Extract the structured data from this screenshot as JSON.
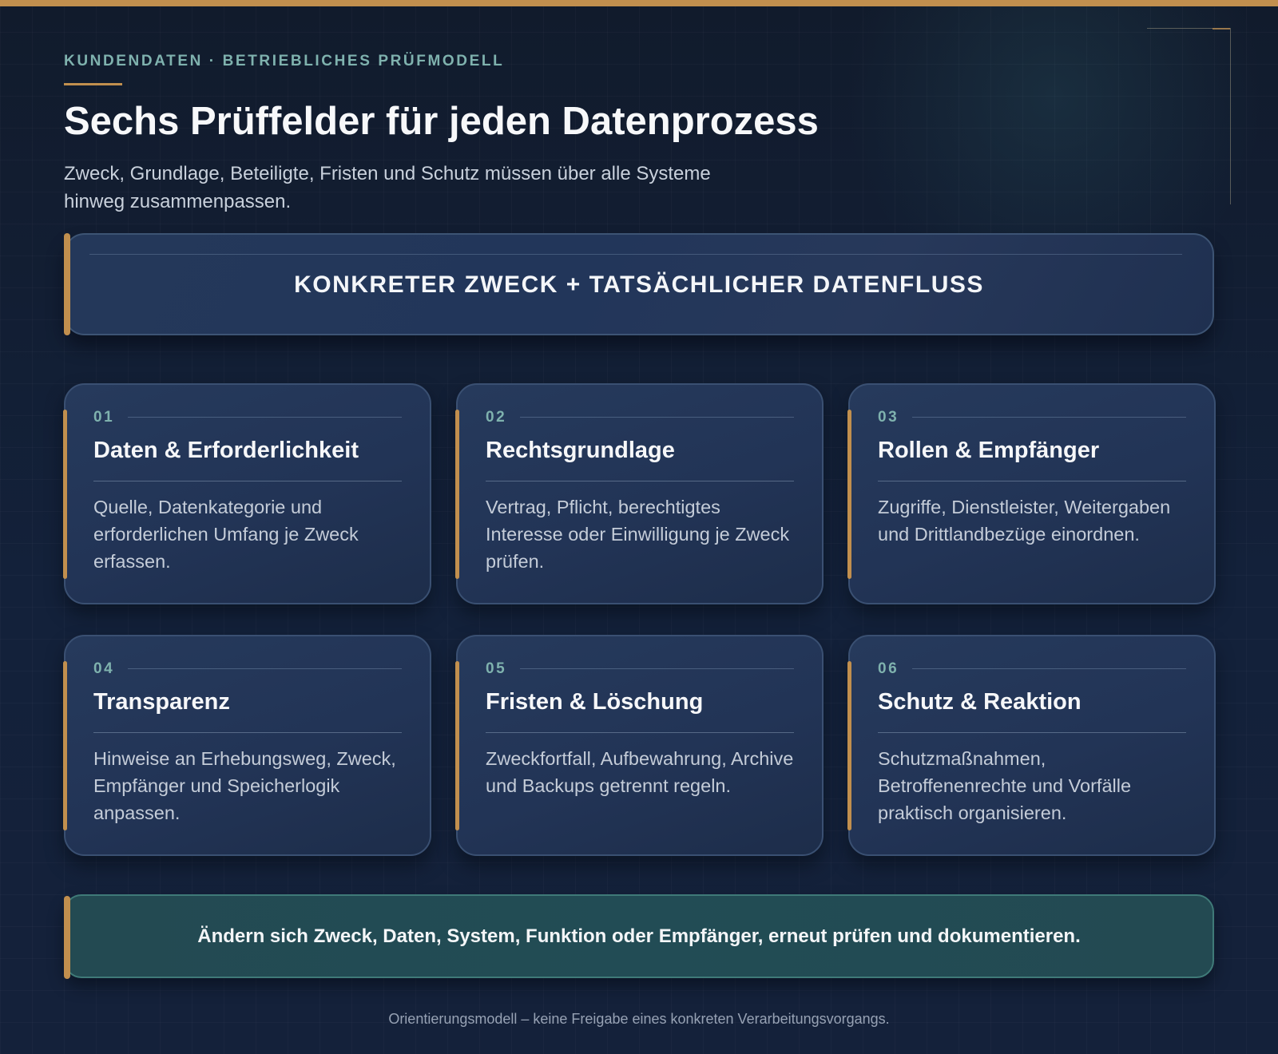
{
  "colors": {
    "accent_gold": "#c18f4e",
    "accent_teal": "#7fb2ae",
    "background": "#13213a",
    "card": "#22365a",
    "note_box": "#234a52"
  },
  "header": {
    "eyebrow": "KUNDENDATEN · BETRIEBLICHES PRÜFMODELL",
    "title": "Sechs Prüffelder für jeden Datenprozess",
    "subtitle": "Zweck, Grundlage, Beteiligte, Fristen und Schutz müssen über alle Systeme hinweg zusammenpassen."
  },
  "banner": {
    "text": "KONKRETER ZWECK + TATSÄCHLICHER DATENFLUSS"
  },
  "cards": [
    {
      "number": "01",
      "title": "Daten & Erforderlichkeit",
      "description": "Quelle, Datenkategorie und erforderlichen Umfang je Zweck erfassen."
    },
    {
      "number": "02",
      "title": "Rechtsgrundlage",
      "description": "Vertrag, Pflicht, berechtigtes Interesse oder Einwilligung je Zweck prüfen."
    },
    {
      "number": "03",
      "title": "Rollen & Empfänger",
      "description": "Zugriffe, Dienstleister, Weitergaben und Drittlandbezüge einordnen."
    },
    {
      "number": "04",
      "title": "Transparenz",
      "description": "Hinweise an Erhebungsweg, Zweck, Empfänger und Speicherlogik anpassen."
    },
    {
      "number": "05",
      "title": "Fristen & Löschung",
      "description": "Zweckfortfall, Aufbewahrung, Archive und Backups getrennt regeln."
    },
    {
      "number": "06",
      "title": "Schutz & Reaktion",
      "description": "Schutzmaßnahmen, Betroffenenrechte und Vorfälle praktisch organisieren."
    }
  ],
  "note": {
    "text": "Ändern sich Zweck, Daten, System, Funktion oder Empfänger, erneut prüfen und dokumentieren."
  },
  "footer": {
    "text": "Orientierungsmodell – keine Freigabe eines konkreten Verarbeitungsvorgangs."
  }
}
